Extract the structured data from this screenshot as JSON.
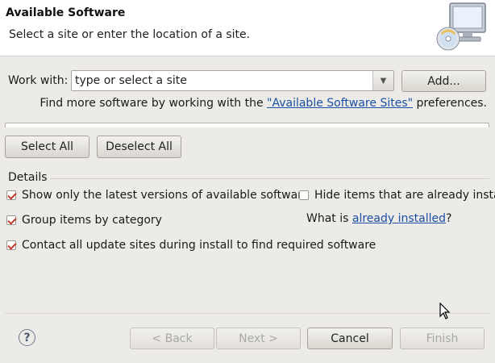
{
  "banner": {
    "title": "Available Software",
    "description": "Select a site or enter the location of a site."
  },
  "work_with": {
    "label": "Work with:",
    "value": "type or select a site",
    "add_button": "Add..."
  },
  "find_more": {
    "prefix": "Find more software by working with the ",
    "link": "\"Available Software Sites\"",
    "suffix": " preferences."
  },
  "buttons": {
    "select_all": "Select All",
    "deselect_all": "Deselect All"
  },
  "details": {
    "label": "Details",
    "options": [
      {
        "label": "Show only the latest versions of available software",
        "checked": true
      },
      {
        "label": "Group items by category",
        "checked": true
      },
      {
        "label": "Contact all update sites during install to find required software",
        "checked": true
      },
      {
        "label": "Hide items that are already instal",
        "checked": false
      }
    ],
    "what_is_prefix": "What is ",
    "what_is_link": "already installed",
    "what_is_suffix": "?"
  },
  "footer": {
    "help": "?",
    "back": "< Back",
    "next": "Next >",
    "cancel": "Cancel",
    "finish": "Finish"
  }
}
